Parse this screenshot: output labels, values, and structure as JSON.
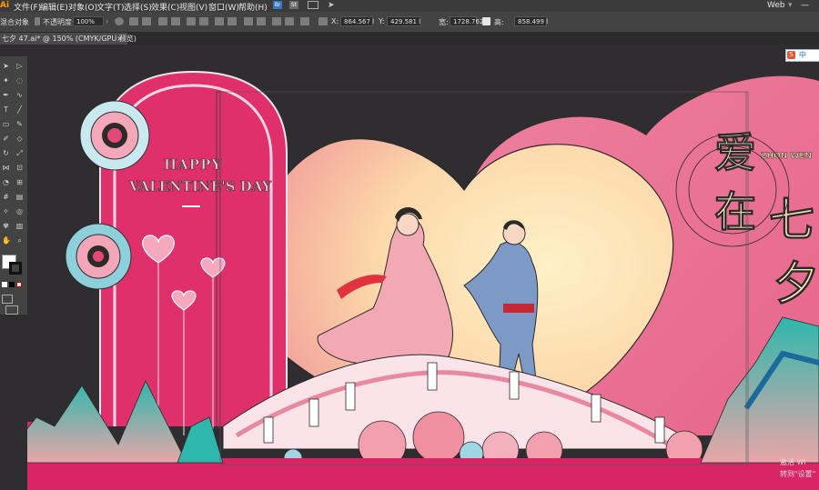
{
  "menubar": {
    "ai_logo": "Ai",
    "items": [
      "文件(F)",
      "编辑(E)",
      "对象(O)",
      "文字(T)",
      "选择(S)",
      "效果(C)",
      "视图(V)",
      "窗口(W)",
      "帮助(H)"
    ],
    "workspace": "Web",
    "bridge_label": "Br",
    "stock_label": "St"
  },
  "control_bar": {
    "selection_label": "混合对象",
    "opacity_label": "不透明度:",
    "opacity_value": "100%",
    "x_label": "X:",
    "x_value": "864.567 l",
    "y_label": "Y:",
    "y_value": "429.581 l",
    "w_label": "宽:",
    "w_value": "1728.762",
    "h_label": "高:",
    "h_value": "858.499 l"
  },
  "document_tab": {
    "title": "七夕 47.ai* @ 150% (CMYK/GPU 预览)",
    "close": "×"
  },
  "ime": {
    "logo": "S",
    "mode": "中"
  },
  "artwork": {
    "happy": "HAPPY",
    "valentines": "VALENTINE'S DAY",
    "title_chars": [
      "爱",
      "在",
      "七",
      "夕"
    ],
    "title_small": "ZHON WEN"
  },
  "watermark": {
    "line1": "激活 Wi",
    "line2": "转到\"设置\""
  },
  "colors": {
    "background": "#2f2d2f",
    "arch_pink": "#e0306c",
    "big_heart": "#ea7394",
    "moon_light": "#fde8bc",
    "moon_peach": "#f3a79c",
    "mountain_teal": "#1e9a8e",
    "floor_pink": "#d82566"
  },
  "icons": [
    "selection-tool-icon",
    "direct-selection-icon",
    "pen-tool-icon",
    "type-tool-icon",
    "zoom-icon",
    "hand-icon"
  ]
}
